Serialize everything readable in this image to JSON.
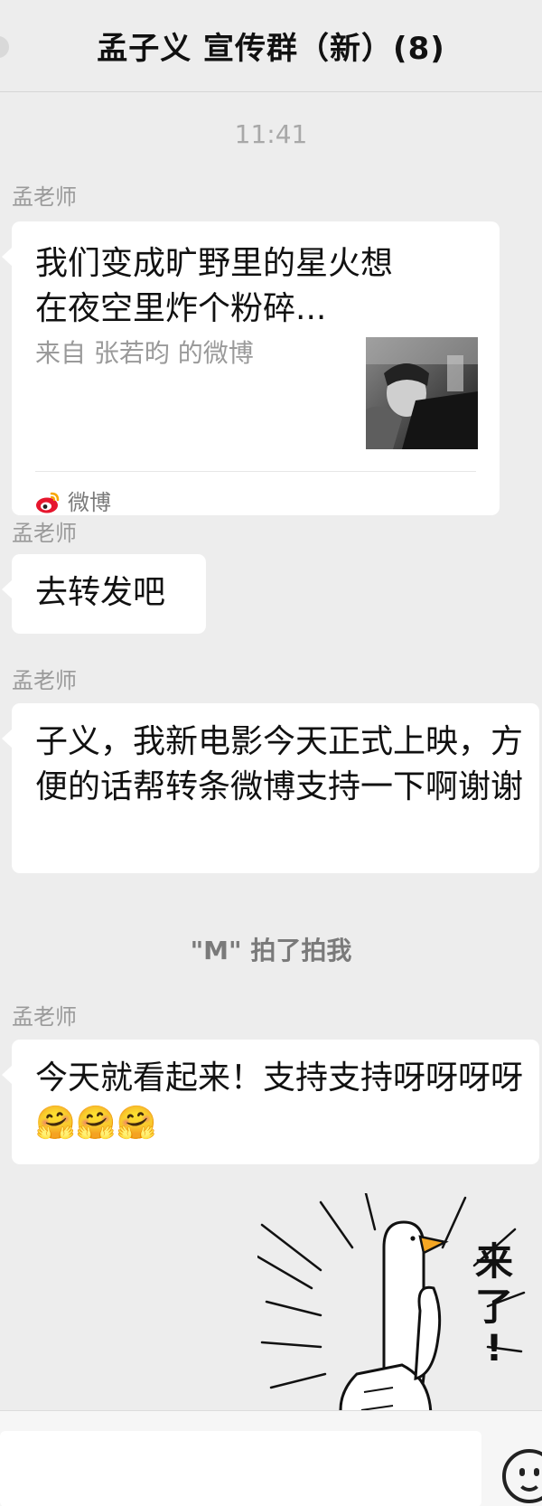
{
  "header": {
    "title": "孟子义 宣传群（新）(8)"
  },
  "chat": {
    "time": "11:41",
    "messages": [
      {
        "sender": "孟老师",
        "card": {
          "title": "我们变成旷野里的星火想在夜空里炸个粉碎...",
          "source": "来自 张若昀 的微博",
          "app": "微博"
        }
      },
      {
        "sender": "孟老师",
        "text": "去转发吧"
      },
      {
        "sender": "孟老师",
        "text": "子义，我新电影今天正式上映，方便的话帮转条微博支持一下啊谢谢"
      },
      {
        "sender": "孟老师",
        "text": "今天就看起来！支持支持呀呀呀呀",
        "emojis": "🤗🤗🤗"
      }
    ],
    "system": "\"M\" 拍了拍我",
    "sticker": {
      "text": "来了!"
    }
  },
  "input": {
    "placeholder": "",
    "value": ""
  },
  "icons": {
    "emoji": "smiley-face-icon",
    "back": "back-icon"
  },
  "colors": {
    "background": "#ededed",
    "bubble": "#ffffff",
    "meta": "#9a9a9a",
    "weibo": "#e6162d"
  }
}
